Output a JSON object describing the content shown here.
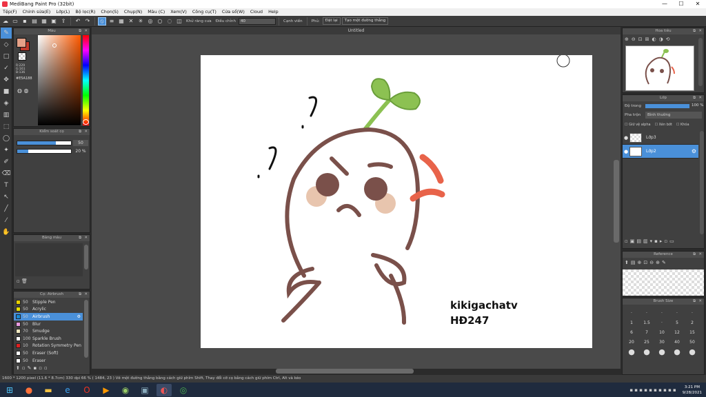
{
  "window": {
    "title": "MediBang Paint Pro (32bit)",
    "controls": [
      "—",
      "☐",
      "✕"
    ]
  },
  "menu": [
    "Tệp(F)",
    "Chỉnh sửa(E)",
    "Lớp(L)",
    "Bộ lọc(R)",
    "Chọn(S)",
    "Chụp(N)",
    "Màu (C)",
    "Xem(V)",
    "Công cụ(T)",
    "Cửa sổ(W)",
    "Cloud",
    "Help"
  ],
  "toolbar": {
    "anti_alias_label": "Khử răng cưa",
    "correction_label": "Điều chỉnh",
    "correction_value": "40",
    "edge_label": "Cạnh viền",
    "page_label": "Phủ:",
    "reset_label": "Đặt lại",
    "line_label": "Tạo một đường thẳng"
  },
  "document": {
    "tab_title": "Untitled"
  },
  "color_panel": {
    "title": "Màu",
    "hex": "#E5A188",
    "values": [
      "R:229",
      "G:161",
      "B:136"
    ]
  },
  "brush_control": {
    "title": "Kiểm soát cọ",
    "size_value": "50",
    "opacity_value": "20 %",
    "size_fill": 0.72,
    "opacity_fill": 0.2
  },
  "palette_panel": {
    "title": "Bảng màu"
  },
  "brush_panel": {
    "title": "Cọ: Airbrush",
    "items": [
      {
        "size": "50",
        "name": "Stipple Pen",
        "color": "#e8d000"
      },
      {
        "size": "50",
        "name": "Acrylic",
        "color": "#e8e000"
      },
      {
        "size": "50",
        "name": "Airbrush",
        "color": "#1a8ad4",
        "selected": true
      },
      {
        "size": "50",
        "name": "Blur",
        "color": "#e89ce0"
      },
      {
        "size": "70",
        "name": "Smudge",
        "color": "#f0e8c0"
      },
      {
        "size": "100",
        "name": "Sparkle Brush",
        "color": "#ffffff"
      },
      {
        "size": "10",
        "name": "Rotation Symmetry Pen",
        "color": "#e02020"
      },
      {
        "size": "50",
        "name": "Eraser (Soft)",
        "color": "#ffffff"
      },
      {
        "size": "50",
        "name": "Eraser",
        "color": "#ffffff"
      }
    ]
  },
  "navigator": {
    "title": "Hoa tiêu"
  },
  "layer_panel": {
    "title": "Lớp",
    "opacity_label": "Độ trong",
    "opacity_value": "100 %",
    "opacity_fill": 1,
    "blend_label": "Pha trộn",
    "blend_value": "Bình thường",
    "protect_alpha": "Giữ vệ alpha",
    "clipping": "Xén bớt",
    "lock": "Khóa",
    "layers": [
      {
        "name": "Lớp3",
        "selected": false
      },
      {
        "name": "Lớp2",
        "selected": true
      }
    ]
  },
  "reference_panel": {
    "title": "Reference"
  },
  "brush_size_panel": {
    "title": "Brush Size",
    "row1": [
      "1",
      "1.5",
      "5",
      "2"
    ],
    "row2": [
      "6",
      "7",
      "10",
      "12",
      "15"
    ],
    "row3": [
      "20",
      "25",
      "30",
      "40",
      "50"
    ]
  },
  "canvas_text": {
    "line1": "kikigachatv",
    "line2": "HĐ247"
  },
  "status": {
    "text": "1600 * 1200 pixel   (11.6 * 8.7cm)   330 dpi   66 %   ( 1484, 23 )   Vẽ một đường thẳng bằng cách giữ phím Shift, Thay đổi cỡ cọ bằng cách giữ phím Ctrl, Alt và kéo"
  },
  "clock": {
    "time": "3:21 PM",
    "date": "9/28/2021"
  },
  "colors": {
    "accent": "#4a90d9",
    "primary_swatch": "#e5a188",
    "sprout": "#8cc152",
    "outline": "#7a504a",
    "blush": "#e5bfa5"
  }
}
